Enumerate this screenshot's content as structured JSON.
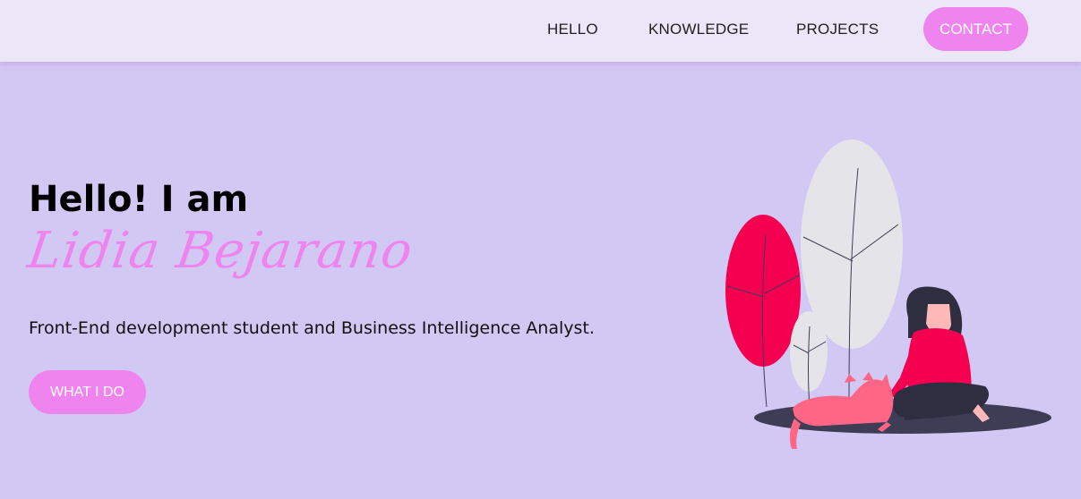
{
  "nav": {
    "items": [
      {
        "label": "HELLO"
      },
      {
        "label": "KNOWLEDGE"
      },
      {
        "label": "PROJECTS"
      }
    ],
    "contact_label": "CONTACT"
  },
  "hero": {
    "greeting": "Hello! I am",
    "name": "Lidia Bejarano",
    "subtitle": "Front-End development student and Business Intelligence Analyst.",
    "cta_label": "WHAT I DO"
  },
  "colors": {
    "accent": "#ef84ef",
    "background": "#d1c8f3",
    "navbar": "#ebe7f9",
    "illustration_red": "#f50050",
    "illustration_gray": "#e5e5e9",
    "illustration_cat": "#ff6584",
    "illustration_dark": "#3f3d56"
  },
  "illustration": {
    "name": "woman-with-cat-illustration"
  }
}
